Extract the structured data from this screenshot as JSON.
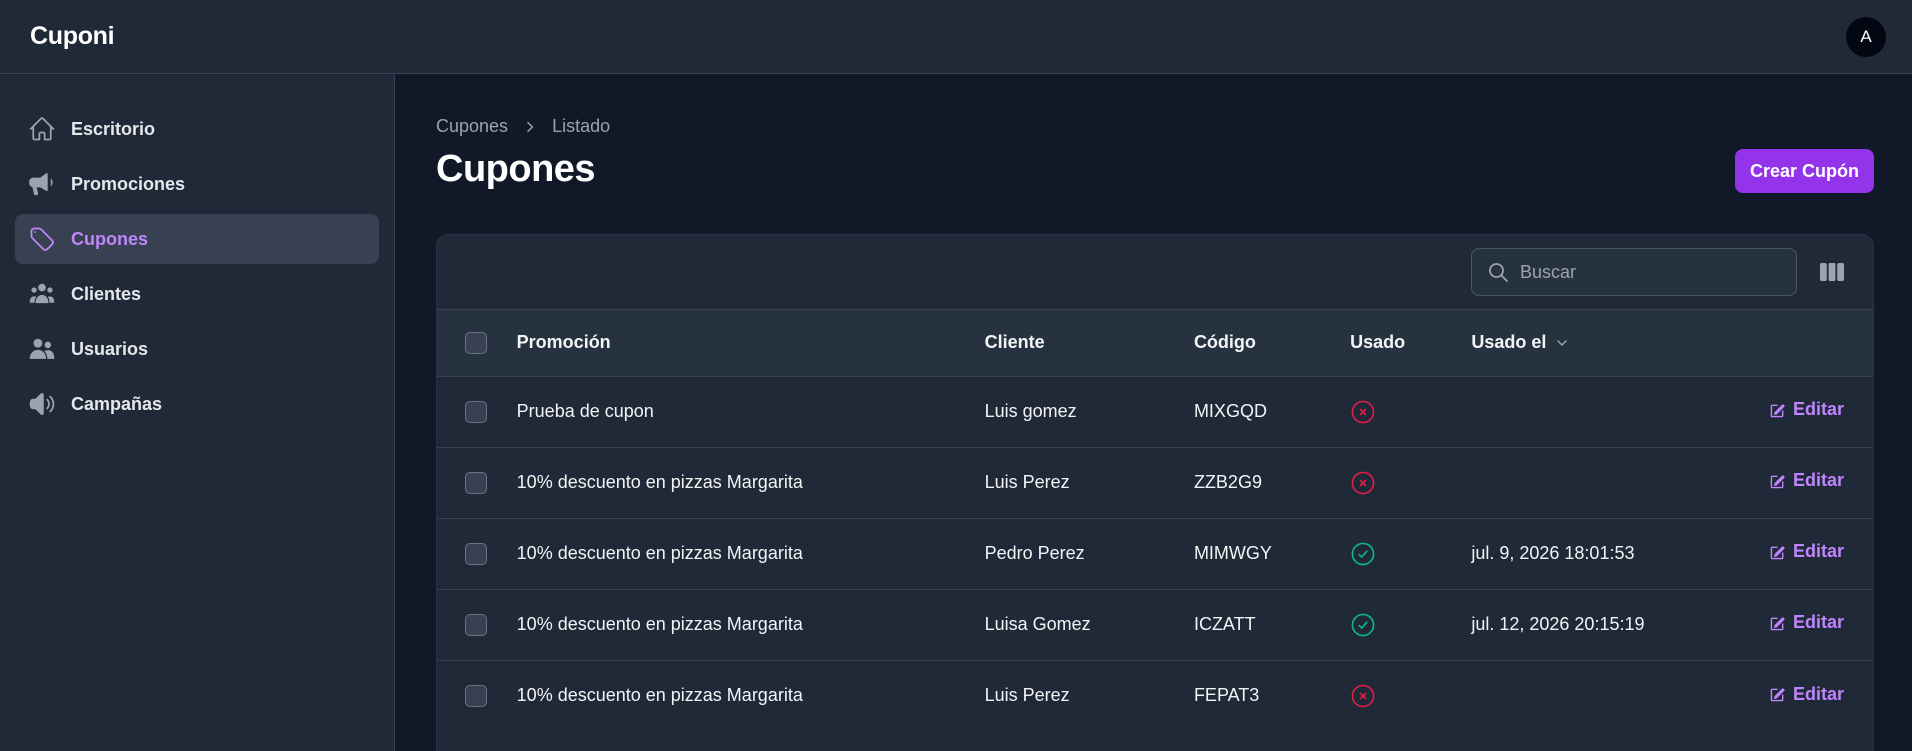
{
  "app": {
    "brand": "Cuponi",
    "avatar_initial": "A"
  },
  "sidebar": {
    "items": [
      {
        "label": "Escritorio",
        "icon": "home-icon",
        "active": false
      },
      {
        "label": "Promociones",
        "icon": "megaphone-icon",
        "active": false
      },
      {
        "label": "Cupones",
        "icon": "tag-icon",
        "active": true
      },
      {
        "label": "Clientes",
        "icon": "user-group-icon",
        "active": false
      },
      {
        "label": "Usuarios",
        "icon": "users-icon",
        "active": false
      },
      {
        "label": "Campañas",
        "icon": "speaker-icon",
        "active": false
      }
    ]
  },
  "breadcrumb": {
    "items": [
      "Cupones",
      "Listado"
    ]
  },
  "page": {
    "title": "Cupones",
    "create_label": "Crear Cupón"
  },
  "search": {
    "placeholder": "Buscar",
    "value": ""
  },
  "table": {
    "columns": [
      "Promoción",
      "Cliente",
      "Código",
      "Usado",
      "Usado el"
    ],
    "sorted_column": "Usado el",
    "edit_label": "Editar",
    "rows": [
      {
        "promocion": "Prueba de cupon",
        "cliente": "Luis gomez",
        "codigo": "MIXGQD",
        "usado": false,
        "usado_el": ""
      },
      {
        "promocion": "10% descuento en pizzas Margarita",
        "cliente": "Luis Perez",
        "codigo": "ZZB2G9",
        "usado": false,
        "usado_el": ""
      },
      {
        "promocion": "10% descuento en pizzas Margarita",
        "cliente": "Pedro Perez",
        "codigo": "MIMWGY",
        "usado": true,
        "usado_el": "jul. 9, 2026 18:01:53"
      },
      {
        "promocion": "10% descuento en pizzas Margarita",
        "cliente": "Luisa Gomez",
        "codigo": "ICZATT",
        "usado": true,
        "usado_el": "jul. 12, 2026 20:15:19"
      },
      {
        "promocion": "10% descuento en pizzas Margarita",
        "cliente": "Luis Perez",
        "codigo": "FEPAT3",
        "usado": false,
        "usado_el": ""
      }
    ]
  },
  "colors": {
    "accent": "#9333ea",
    "accent_text": "#c084fc",
    "used_true": "#10b981",
    "used_false": "#e11d48",
    "icon_gray": "#9ca3af"
  }
}
